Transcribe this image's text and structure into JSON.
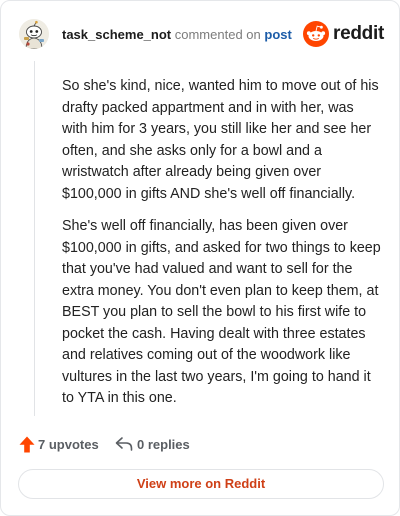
{
  "header": {
    "username": "task_scheme_not",
    "commented_text": "commented on",
    "post_link": "post",
    "brand_name": "reddit",
    "brand_icon": "reddit-logo-icon",
    "avatar_icon": "snoo-avatar"
  },
  "comment": {
    "paragraphs": [
      "So she's kind, nice, wanted him to move out of his drafty packed appartment and in with her, was with him for 3 years, you still like her and see her often, and she asks only for a bowl and a wristwatch after already being given over $100,000 in gifts AND she's well off financially.",
      "She's well off financially, has been given over $100,000 in gifts, and asked for two things to keep that you've had valued and want to sell for the extra money. You don't even plan to keep them, at BEST you plan to sell the bowl to his first wife to pocket the cash. Having dealt with three estates and relatives coming out of the woodwork like vultures in the last two years, I'm going to hand it to YTA in this one."
    ]
  },
  "actions": {
    "upvotes": "7 upvotes",
    "replies": "0 replies",
    "upvote_icon": "upvote-arrow-icon",
    "reply_icon": "reply-icon"
  },
  "footer": {
    "view_more": "View more on Reddit"
  },
  "colors": {
    "brand_orange": "#ff4500",
    "link_blue": "#1c5ca8",
    "view_more_red": "#cf3f16"
  }
}
